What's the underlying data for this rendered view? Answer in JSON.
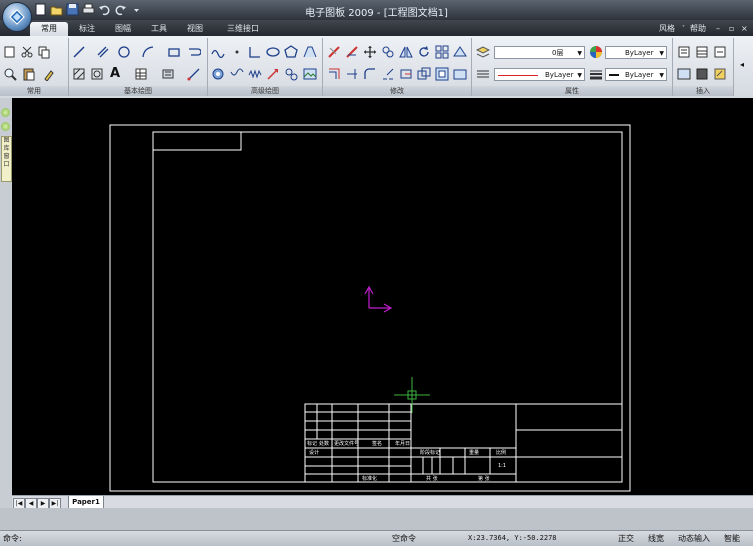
{
  "window": {
    "title": "电子图板 2009 - [工程图文档1]",
    "qat_icons": [
      "new-icon",
      "open-icon",
      "save-icon",
      "print-icon",
      "undo-icon",
      "redo-icon",
      "qat-menu-icon"
    ]
  },
  "tabs": [
    {
      "label": "常用",
      "active": true
    },
    {
      "label": "标注",
      "active": false
    },
    {
      "label": "图幅",
      "active": false
    },
    {
      "label": "工具",
      "active": false
    },
    {
      "label": "视图",
      "active": false
    },
    {
      "label": "三维接口",
      "active": false
    }
  ],
  "right_menu": {
    "style_label": "风格",
    "help_label": "帮助"
  },
  "ribbon_groups": {
    "common": "常用",
    "basic_draw": "基本绘图",
    "advanced_draw": "高级绘图",
    "modify": "修改",
    "properties": "属性",
    "insert": "插入"
  },
  "properties": {
    "layer_value": "0层",
    "color_value": "ByLayer",
    "linetype_value": "ByLayer",
    "lineweight_value": "ByLayer"
  },
  "drawing": {
    "title_block_labels": {
      "marks": "标记",
      "count": "处数",
      "zone": "分区",
      "change_doc": "更改文件号",
      "sign": "签名",
      "date": "年月日",
      "design": "设计",
      "standardize": "标准化",
      "stage_mark": "阶段标记",
      "weight": "重量",
      "scale": "比例",
      "scale_value": "1:1",
      "review": "审核",
      "process": "工艺",
      "approve": "批准",
      "sheets": "共 张",
      "sheet": "第 张"
    }
  },
  "left_panel": {
    "label": "图\n库\n窗\n口"
  },
  "paper_tab": "Paper1",
  "nav_buttons": [
    "|◀",
    "◀",
    "▶",
    "▶|"
  ],
  "command_prompt": "命令:",
  "status": {
    "command_text": "空命令",
    "coordinates": "X:23.7364, Y:-50.2278",
    "ortho": "正交",
    "lineweight": "线宽",
    "dynamic_input": "动态输入",
    "snap": "智能"
  },
  "colors": {
    "canvas": "#000000",
    "ucs": "#c21fd0",
    "cursor": "#3eb43e",
    "frame": "#ffffff"
  }
}
